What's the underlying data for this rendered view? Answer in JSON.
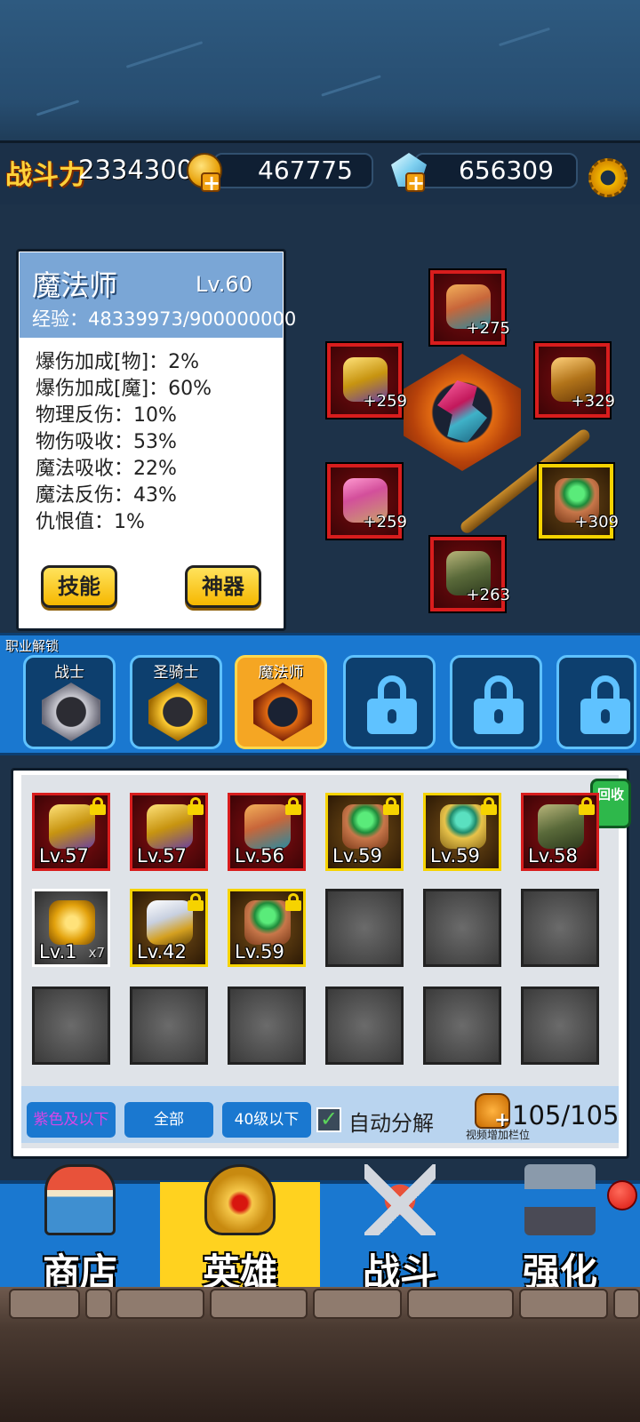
{
  "top_bar": {
    "power_label": "战斗力",
    "power_value": "2334300",
    "gold": "467775",
    "diamonds": "656309",
    "settings_icon": "gear-icon",
    "coin_icon": "gold-coin-icon",
    "gem_icon": "diamond-icon"
  },
  "hero": {
    "name": "魔法师",
    "level": "Lv.60",
    "exp_label": "经验",
    "exp_value": "48339973/900000000",
    "stats": [
      "爆伤加成[物]：2%",
      "爆伤加成[魔]：60%",
      "物理反伤：10%",
      "物伤吸收：53%",
      "魔法吸收：22%",
      "魔法反伤：43%",
      "仇恨值：1%"
    ],
    "skill_button": "技能",
    "artifact_button": "神器"
  },
  "equipment": [
    {
      "slot": "helmet",
      "bonus": "+275",
      "icon": "horned-helmet-icon"
    },
    {
      "slot": "armor",
      "bonus": "+259",
      "icon": "gold-armor-icon"
    },
    {
      "slot": "weapon",
      "bonus": "+329",
      "icon": "eagle-staff-icon"
    },
    {
      "slot": "bracer",
      "bonus": "+259",
      "icon": "bracer-icon"
    },
    {
      "slot": "ring",
      "bonus": "+309",
      "icon": "emerald-ring-icon"
    },
    {
      "slot": "boots",
      "bonus": "+263",
      "icon": "boots-icon"
    }
  ],
  "classes": {
    "title": "职业解锁",
    "items": [
      {
        "name": "战士",
        "state": "unlocked"
      },
      {
        "name": "圣骑士",
        "state": "unlocked"
      },
      {
        "name": "魔法师",
        "state": "active"
      },
      {
        "name": "",
        "state": "locked"
      },
      {
        "name": "",
        "state": "locked"
      },
      {
        "name": "",
        "state": "locked"
      }
    ]
  },
  "inventory": {
    "recycle_label": "回收",
    "items": [
      {
        "level": "Lv.57",
        "rarity": "red",
        "locked": true,
        "icon": "gold-armor-icon"
      },
      {
        "level": "Lv.57",
        "rarity": "red",
        "locked": true,
        "icon": "gold-armor-icon"
      },
      {
        "level": "Lv.56",
        "rarity": "red",
        "locked": true,
        "icon": "horned-helmet-icon"
      },
      {
        "level": "Lv.59",
        "rarity": "yellow",
        "locked": true,
        "icon": "emerald-ring-icon"
      },
      {
        "level": "Lv.59",
        "rarity": "yellow",
        "locked": true,
        "icon": "gold-ring-icon"
      },
      {
        "level": "Lv.58",
        "rarity": "red",
        "locked": true,
        "icon": "boots-icon"
      },
      {
        "level": "Lv.1",
        "rarity": "white",
        "locked": false,
        "icon": "gold-orb-icon",
        "count": "x7"
      },
      {
        "level": "Lv.42",
        "rarity": "yellow",
        "locked": true,
        "icon": "winged-helmet-icon"
      },
      {
        "level": "Lv.59",
        "rarity": "yellow",
        "locked": true,
        "icon": "emerald-ring-icon"
      }
    ],
    "filters": [
      "紫色及以下",
      "全部",
      "40级以下"
    ],
    "auto_decompose_label": "自动分解",
    "auto_decompose_checked": true,
    "capacity": "105/105",
    "video_add_slots": "视频增加栏位"
  },
  "nav": {
    "tabs": [
      {
        "label": "商店",
        "icon": "shop-icon"
      },
      {
        "label": "英雄",
        "icon": "hero-helmet-icon",
        "selected": true
      },
      {
        "label": "战斗",
        "icon": "crossed-swords-icon"
      },
      {
        "label": "强化",
        "icon": "hammer-anvil-icon"
      }
    ],
    "notification_dot": "red"
  },
  "colors": {
    "accent_blue": "#1a78d0",
    "rarity_red": "#d81d1d",
    "rarity_yellow": "#f6d300",
    "nav_selected": "#ffd21f"
  }
}
